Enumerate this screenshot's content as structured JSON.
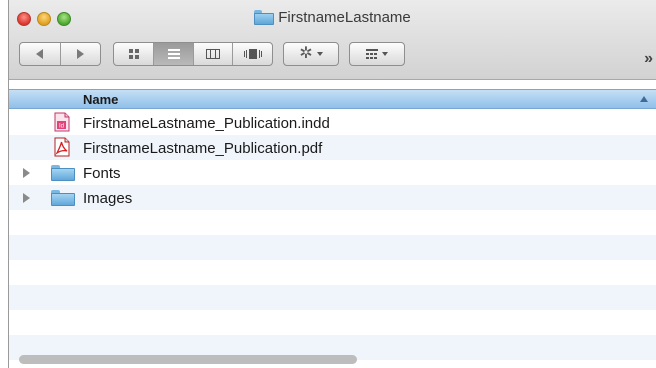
{
  "window": {
    "title": "FirstnameLastname"
  },
  "toolbar": {
    "overflow_label": "»"
  },
  "list": {
    "column_header": "Name",
    "rows": [
      {
        "label": "FirstnameLastname_Publication.indd",
        "icon": "indd-file-icon",
        "badge": "Id"
      },
      {
        "label": "FirstnameLastname_Publication.pdf",
        "icon": "pdf-file-icon"
      },
      {
        "label": "Fonts",
        "icon": "folder-icon"
      },
      {
        "label": "Images",
        "icon": "folder-icon"
      }
    ]
  },
  "colors": {
    "header_blue": "#9cc7ec",
    "indd_pink": "#e0447b",
    "pdf_red": "#d42020",
    "folder_blue": "#6fb0dd"
  }
}
